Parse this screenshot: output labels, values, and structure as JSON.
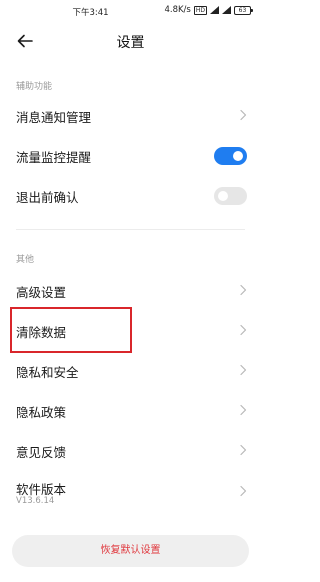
{
  "status_bar": {
    "time": "下午3:41",
    "network_speed": "4.8K/s",
    "hd_badge": "HD",
    "battery": "63"
  },
  "header": {
    "title": "设置"
  },
  "section_accessibility": {
    "label": "辅助功能",
    "items": [
      {
        "label": "消息通知管理"
      },
      {
        "label": "流量监控提醒",
        "toggle": true
      },
      {
        "label": "退出前确认",
        "toggle": false
      }
    ]
  },
  "section_other": {
    "label": "其他",
    "items": [
      {
        "label": "高级设置"
      },
      {
        "label": "清除数据"
      },
      {
        "label": "隐私和安全"
      },
      {
        "label": "隐私政策"
      },
      {
        "label": "意见反馈"
      },
      {
        "label": "软件版本",
        "sub": "V13.6.14"
      }
    ]
  },
  "footer": {
    "reset_label": "恢复默认设置"
  },
  "colors": {
    "accent": "#1f7df0",
    "danger": "#e0383e",
    "highlight_box": "#d9262b"
  },
  "icons": [
    "back-arrow-icon",
    "chevron-right-icon",
    "signal-icon",
    "battery-icon"
  ]
}
